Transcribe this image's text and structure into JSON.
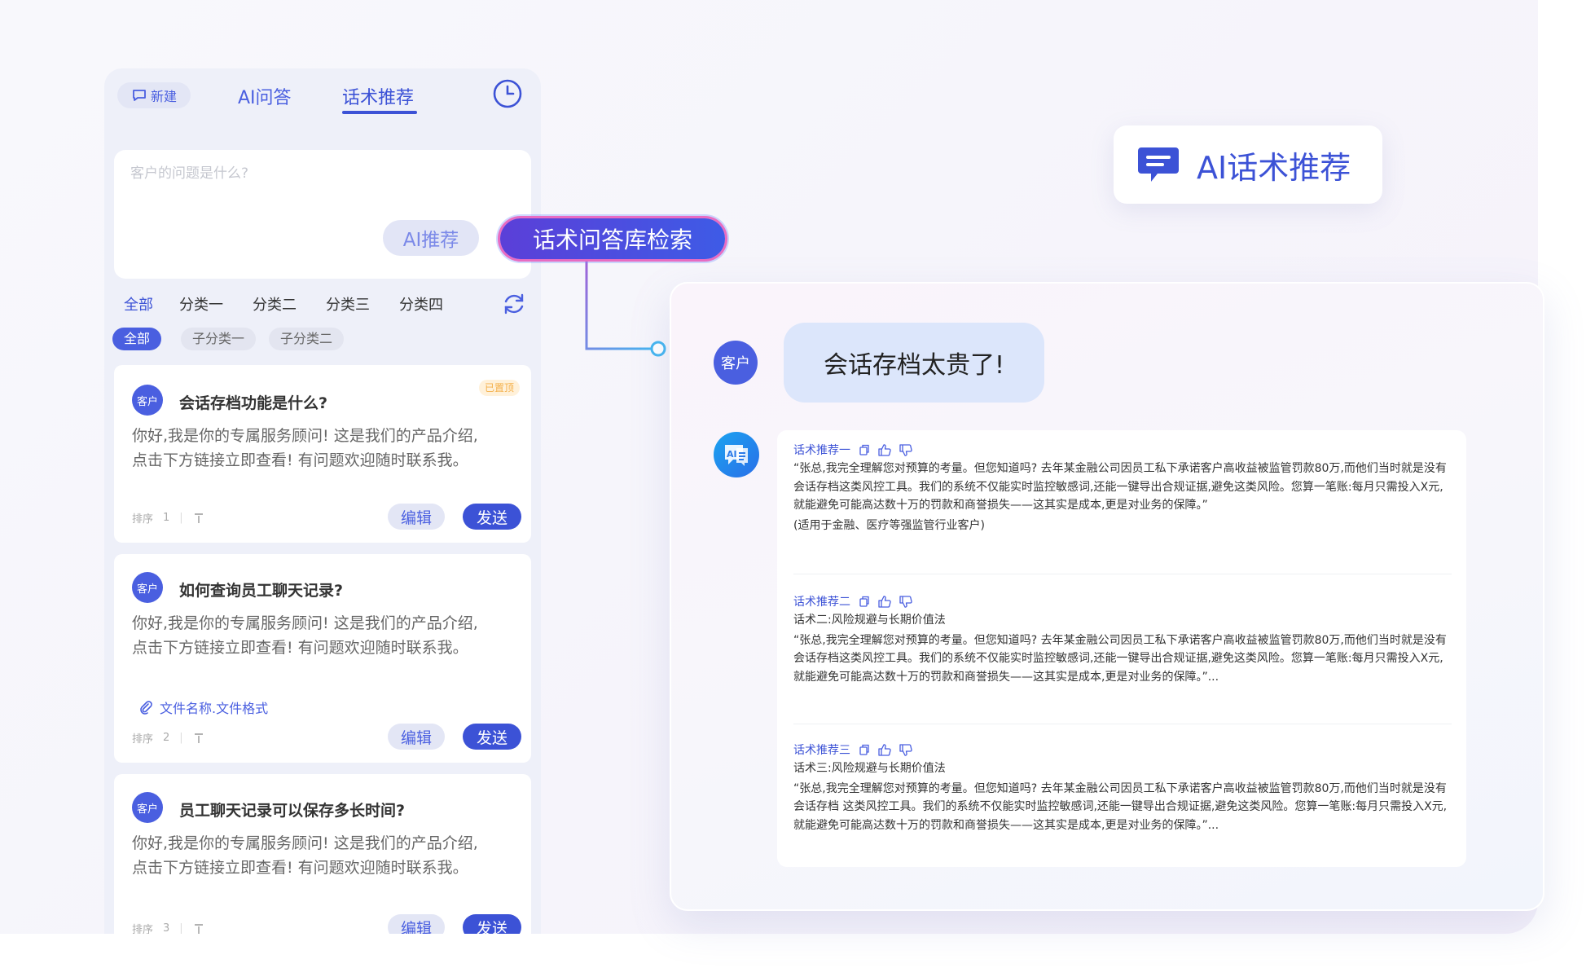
{
  "left_panel": {
    "new_label": "新建",
    "tabs": [
      "AI问答",
      "话术推荐"
    ],
    "query_placeholder": "客户的问题是什么?",
    "ai_recommend_label": "AI推荐",
    "categories": [
      "全部",
      "分类一",
      "分类二",
      "分类三",
      "分类四"
    ],
    "subcategories": [
      "全部",
      "子分类一",
      "子分类二"
    ],
    "cards": [
      {
        "avatar": "客户",
        "question": "会话存档功能是什么?",
        "badge": "已置顶",
        "answer": "你好,我是你的专属服务顾问! 这是我们的产品介绍,点击下方链接立即查看! 有问题欢迎随时联系我。",
        "sort_label": "排序",
        "sort_value": "1",
        "edit_label": "编辑",
        "send_label": "发送"
      },
      {
        "avatar": "客户",
        "question": "如何查询员工聊天记录?",
        "answer": "你好,我是你的专属服务顾问! 这是我们的产品介绍,点击下方链接立即查看! 有问题欢迎随时联系我。",
        "attachment": "文件名称.文件格式",
        "sort_label": "排序",
        "sort_value": "2",
        "edit_label": "编辑",
        "send_label": "发送"
      },
      {
        "avatar": "客户",
        "question": "员工聊天记录可以保存多长时间?",
        "answer": "你好,我是你的专属服务顾问! 这是我们的产品介绍,点击下方链接立即查看! 有问题欢迎随时联系我。",
        "sort_label": "排序",
        "sort_value": "3",
        "edit_label": "编辑",
        "send_label": "发送"
      }
    ]
  },
  "connector_label": "话术问答库检索",
  "ai_header_title": "AI话术推荐",
  "chat": {
    "user_avatar": "客户",
    "user_message": "会话存档太贵了!",
    "recommendations": [
      {
        "title": "话术推荐一",
        "subtitle": "",
        "text": "“张总,我完全理解您对预算的考量。但您知道吗? 去年某金融公司因员工私下承诺客户高收益被监管罚款80万,而他们当时就是没有会话存档这类风控工具。我们的系统不仅能实时监控敏感词,还能一键导出合规证据,避免这类风险。您算一笔账:每月只需投入X元,就能避免可能高达数十万的罚款和商誉损失——这其实是成本,更是对业务的保障。”",
        "note": "(适用于金融、医疗等强监管行业客户)"
      },
      {
        "title": "话术推荐二",
        "subtitle": "话术二:风险规避与长期价值法",
        "text": "“张总,我完全理解您对预算的考量。但您知道吗? 去年某金融公司因员工私下承诺客户高收益被监管罚款80万,而他们当时就是没有会话存档这类风控工具。我们的系统不仅能实时监控敏感词,还能一键导出合规证据,避免这类风险。您算一笔账:每月只需投入X元,就能避免可能高达数十万的罚款和商誉损失——这其实是成本,更是对业务的保障。”...",
        "note": ""
      },
      {
        "title": "话术推荐三",
        "subtitle": "话术三:风险规避与长期价值法",
        "text": "“张总,我完全理解您对预算的考量。但您知道吗? 去年某金融公司因员工私下承诺客户高收益被监管罚款80万,而他们当时就是没有会话存档 这类风控工具。我们的系统不仅能实时监控敏感词,还能一键导出合规证据,避免这类风险。您算一笔账:每月只需投入X元,就能避免可能高达数十万的罚款和商誉损失——这其实是成本,更是对业务的保障。”...",
        "note": ""
      }
    ]
  },
  "colors": {
    "brand": "#3c52d6",
    "brand_light": "#e3e6f5",
    "pinned": "#f4b04a",
    "connector_glow": "#e86cc2"
  },
  "icons": {
    "new": "new-chat-icon",
    "history": "clock-icon",
    "refresh": "refresh-icon",
    "pin": "pin-top-icon",
    "attach": "paperclip-icon",
    "copy": "copy-icon",
    "like": "thumbs-up-icon",
    "dislike": "thumbs-down-icon",
    "ai_header": "chat-bubble-icon"
  }
}
